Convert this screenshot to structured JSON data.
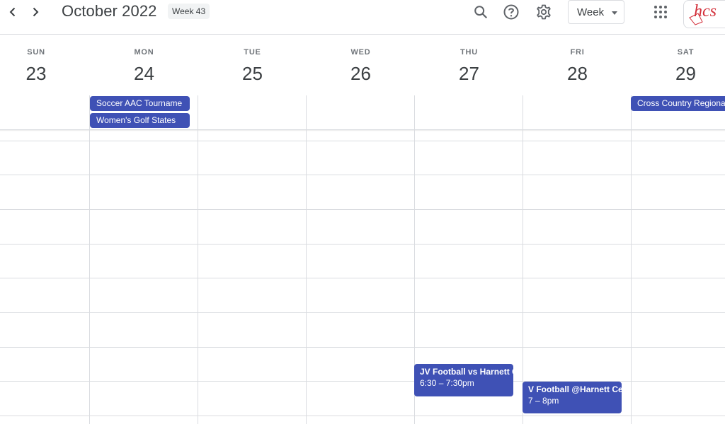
{
  "header": {
    "month_title": "October 2022",
    "week_badge": "Week 43",
    "view_label": "Week",
    "logo_text": "hcs"
  },
  "icons": {
    "prev": "chevron-left-icon",
    "next": "chevron-right-icon",
    "search": "search-icon",
    "help": "help-icon",
    "settings": "gear-icon",
    "apps": "apps-grid-icon"
  },
  "days": [
    {
      "dow": "SUN",
      "num": "23"
    },
    {
      "dow": "MON",
      "num": "24"
    },
    {
      "dow": "TUE",
      "num": "25"
    },
    {
      "dow": "WED",
      "num": "26"
    },
    {
      "dow": "THU",
      "num": "27"
    },
    {
      "dow": "FRI",
      "num": "28"
    },
    {
      "dow": "SAT",
      "num": "29"
    }
  ],
  "all_day_events": [
    {
      "title": "Soccer AAC Tourname"
    },
    {
      "title": "Women's Golf States"
    },
    {
      "title": "Cross Country Regiona"
    }
  ],
  "timed_events": [
    {
      "title": "JV Football vs Harnett C",
      "time": "6:30 – 7:30pm"
    },
    {
      "title": "V Football @Harnett Cen",
      "time": "7 – 8pm"
    }
  ],
  "colors": {
    "event": "#3f51b5",
    "grid": "#dadce0",
    "logo": "#d32f3a"
  }
}
